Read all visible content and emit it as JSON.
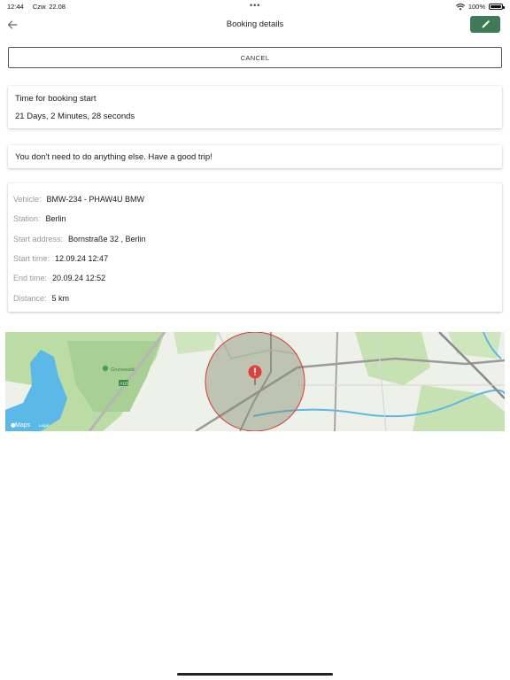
{
  "status_bar": {
    "time": "12:44",
    "date": "Czw. 22.08",
    "more_dots": "•••",
    "battery_text": "100%",
    "battery_level": 1.0
  },
  "header": {
    "title": "Booking details",
    "back_icon": "arrow-left-icon",
    "edit_icon": "pencil-icon",
    "edit_button_color": "#3f7a56"
  },
  "cancel_button": {
    "label": "CANCEL"
  },
  "booking_timer": {
    "label": "Time for booking start",
    "value": "21 Days, 2 Minutes, 28 seconds"
  },
  "message": {
    "text": "You don't need to do anything else. Have a good trip!"
  },
  "details": {
    "vehicle": {
      "label": "Vehicle:",
      "value": "BMW-234 - PHAW4U BMW"
    },
    "station": {
      "label": "Station:",
      "value": "Berlin"
    },
    "start_address": {
      "label": "Start address:",
      "value": "Bornstraße 32 , Berlin"
    },
    "start_time": {
      "label": "Start time:",
      "value": "12.09.24 12:47"
    },
    "end_time": {
      "label": "End time:",
      "value": "20.09.24 12:52"
    },
    "distance": {
      "label": "Distance:",
      "value": "5 km"
    }
  },
  "map": {
    "poi_label": "Grunewald",
    "road_shield": "A115",
    "attribution": "Maps",
    "legal": "Legal",
    "pin_icon": "map-pin-icon",
    "circle_color": "#d93a32",
    "water_color": "#5cb8e6",
    "park_color": "#bcdca6"
  }
}
